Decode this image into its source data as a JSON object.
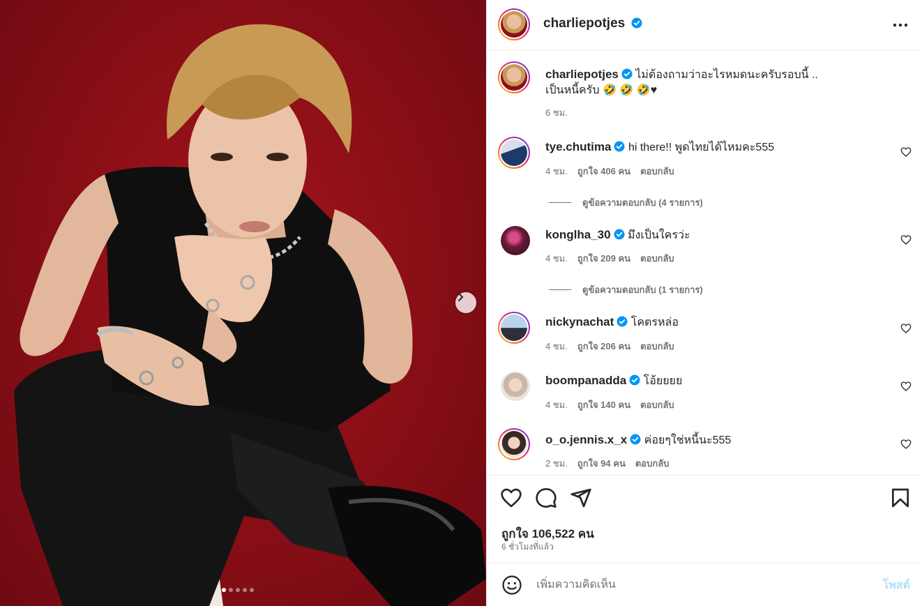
{
  "media": {
    "carousel": {
      "count": 5,
      "active_index": 0
    },
    "next_icon": "chevron-right-icon"
  },
  "header": {
    "username": "charliepotjes",
    "verified_icon": "verified-badge-icon",
    "more_icon": "more-horizontal-icon"
  },
  "caption": {
    "username": "charliepotjes",
    "text_line1": "ไม่ต้องถามว่าอะไรหมดนะครับรอบนี้ ..",
    "text_line2": "เป็นหนี้ครับ 🤣 🤣 🤣♥",
    "time": "6 ชม."
  },
  "comments": [
    {
      "username": "tye.chutima",
      "text": "hi there!! พูดไทยได้ไหมคะ555",
      "time": "4 ชม.",
      "likes": "ถูกใจ 406 คน",
      "reply": "ตอบกลับ",
      "view_replies": "ดูข้อความตอบกลับ (4 รายการ)"
    },
    {
      "username": "konglha_30",
      "text": "มึงเป็นใครว่ะ",
      "time": "4 ชม.",
      "likes": "ถูกใจ 209 คน",
      "reply": "ตอบกลับ",
      "view_replies": "ดูข้อความตอบกลับ (1 รายการ)"
    },
    {
      "username": "nickynachat",
      "text": "โคตรหล่อ",
      "time": "4 ชม.",
      "likes": "ถูกใจ 206 คน",
      "reply": "ตอบกลับ"
    },
    {
      "username": "boompanadda",
      "text": "โอ้ยยยย",
      "time": "4 ชม.",
      "likes": "ถูกใจ 140 คน",
      "reply": "ตอบกลับ"
    },
    {
      "username": "o_o.jennis.x_x",
      "text": "ค่อยๆใช่หนี้นะ555",
      "time": "2 ชม.",
      "likes": "ถูกใจ 94 คน",
      "reply": "ตอบกลับ"
    }
  ],
  "actions": {
    "likes": "ถูกใจ 106,522 คน",
    "posted": "6 ชั่วโมงที่แล้ว",
    "icons": [
      "heart-icon",
      "comment-icon",
      "share-icon",
      "bookmark-icon"
    ]
  },
  "composer": {
    "placeholder": "เพิ่มความคิดเห็น",
    "post_label": "โพสต์",
    "emoji_icon": "emoji-icon"
  },
  "colors": {
    "background_red": "#8d0f17",
    "verified_blue": "#0095f6",
    "muted_text": "#737373",
    "post_disabled": "#b2dffc"
  }
}
